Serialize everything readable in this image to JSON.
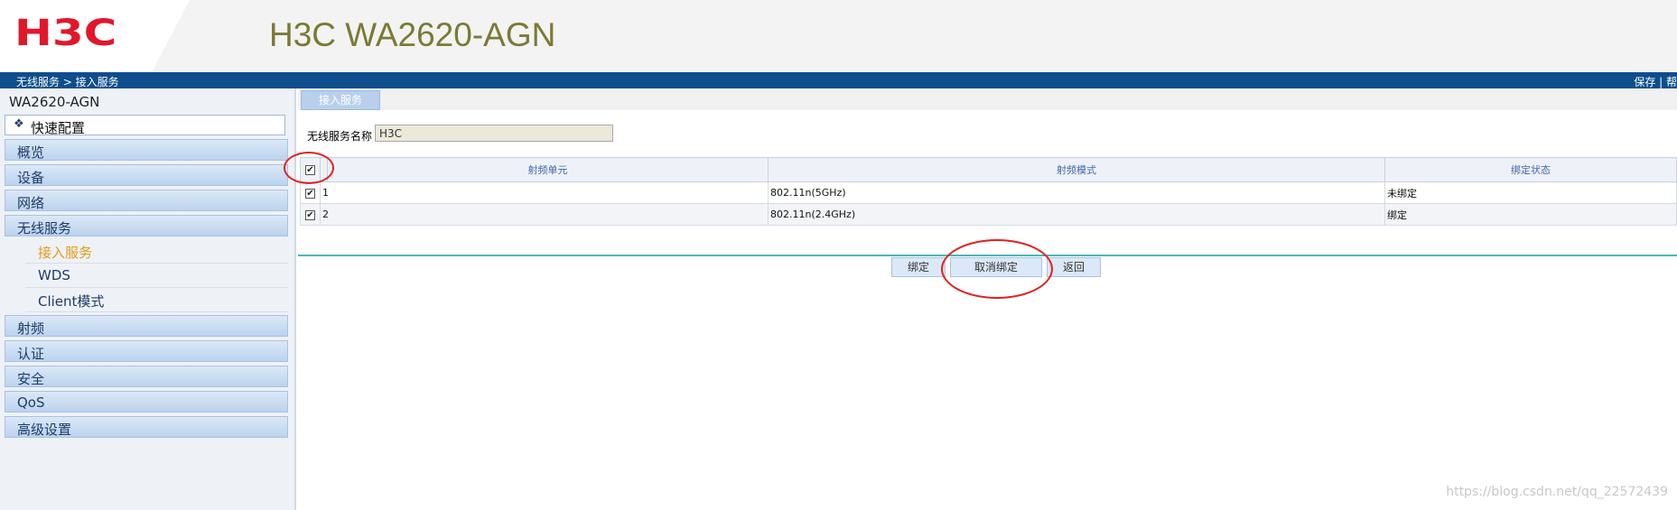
{
  "header": {
    "logo_text": "H3C",
    "device_title": "H3C WA2620-AGN"
  },
  "topbar": {
    "breadcrumb": "无线服务 > 接入服务",
    "links": "保存 | 帮"
  },
  "sidebar": {
    "device_name": "WA2620-AGN",
    "quick_config": "快速配置",
    "items": [
      {
        "label": "概览"
      },
      {
        "label": "设备"
      },
      {
        "label": "网络"
      },
      {
        "label": "无线服务"
      }
    ],
    "subitems": [
      {
        "label": "接入服务",
        "active": true
      },
      {
        "label": "WDS",
        "active": false
      },
      {
        "label": "Client模式",
        "active": false
      }
    ],
    "items_after": [
      {
        "label": "射频"
      },
      {
        "label": "认证"
      },
      {
        "label": "安全"
      },
      {
        "label": "QoS"
      },
      {
        "label": "高级设置"
      }
    ]
  },
  "content": {
    "tab_label": "接入服务",
    "service_name_label": "无线服务名称",
    "service_name_value": "H3C",
    "table": {
      "headers": [
        "射频单元",
        "射频模式",
        "绑定状态"
      ],
      "rows": [
        {
          "checked": true,
          "unit": "1",
          "mode": "802.11n(5GHz)",
          "status": "未绑定"
        },
        {
          "checked": true,
          "unit": "2",
          "mode": "802.11n(2.4GHz)",
          "status": "绑定"
        }
      ]
    },
    "buttons": {
      "bind": "绑定",
      "unbind": "取消绑定",
      "back": "返回"
    }
  },
  "watermark": "https://blog.csdn.net/qq_22572439",
  "colors": {
    "brand_red": "#e1182a",
    "topbar_blue": "#0e4e8c",
    "active_orange": "#e59a17",
    "annotation_red": "#e02020"
  }
}
